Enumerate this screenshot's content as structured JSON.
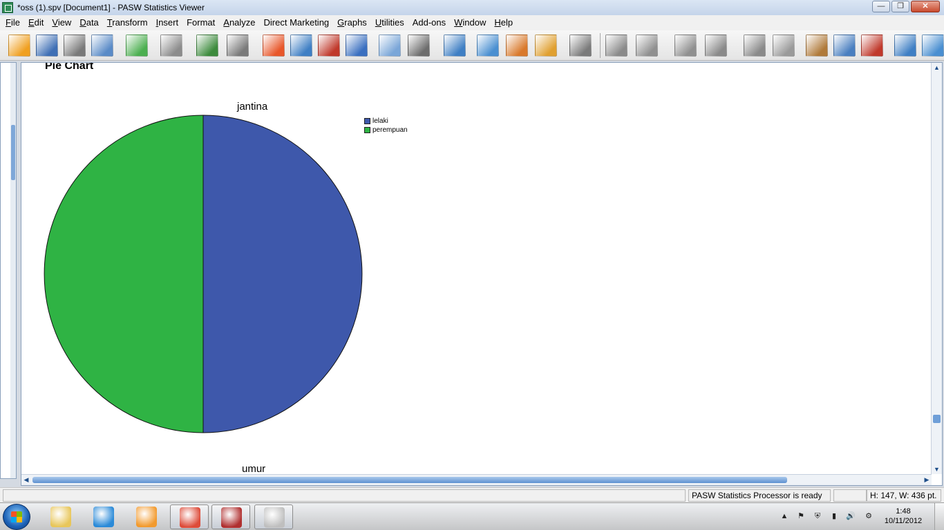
{
  "window": {
    "title": "*oss (1).spv [Document1] - PASW Statistics Viewer",
    "minimize_glyph": "—",
    "maximize_glyph": "❐",
    "close_glyph": "✕"
  },
  "menu": [
    {
      "label": "File",
      "accel": "F",
      "rest": "ile"
    },
    {
      "label": "Edit",
      "accel": "E",
      "rest": "dit"
    },
    {
      "label": "View",
      "accel": "V",
      "rest": "iew"
    },
    {
      "label": "Data",
      "accel": "D",
      "rest": "ata"
    },
    {
      "label": "Transform",
      "accel": "T",
      "rest": "ransform"
    },
    {
      "label": "Insert",
      "accel": "I",
      "rest": "nsert"
    },
    {
      "label": "Format",
      "accel": "",
      "rest": "Format"
    },
    {
      "label": "Analyze",
      "accel": "A",
      "rest": "nalyze"
    },
    {
      "label": "Direct Marketing",
      "accel": "",
      "rest": "Direct Marketing"
    },
    {
      "label": "Graphs",
      "accel": "G",
      "rest": "raphs"
    },
    {
      "label": "Utilities",
      "accel": "U",
      "rest": "tilities"
    },
    {
      "label": "Add-ons",
      "accel": "",
      "rest": "Add-ons"
    },
    {
      "label": "Window",
      "accel": "W",
      "rest": "indow"
    },
    {
      "label": "Help",
      "accel": "H",
      "rest": "elp"
    }
  ],
  "toolbar_icons": [
    "open-folder-icon",
    "save-icon",
    "print-icon",
    "print-preview-icon",
    "export-icon",
    "recall-dialog-icon",
    "undo-icon",
    "redo-icon",
    "goto-output-icon",
    "goto-case-icon",
    "goto-variable-icon",
    "variables-icon",
    "show-all-variables-icon",
    "hide-icon",
    "show-icon",
    "designate-window-icon",
    "insert-heading-icon",
    "insert-title-icon",
    "insert-text-icon",
    "insert-object-icon",
    "promote-icon",
    "demote-icon",
    "expand-icon",
    "collapse-icon",
    "show-item-icon",
    "hide-item-icon",
    "select-last-output-icon",
    "designate-viewer-icon",
    "create-pivot-icon",
    "output-options-icon"
  ],
  "viewer": {
    "section_heading": "Pie Chart",
    "next_chart_title": "umur"
  },
  "chart_data": {
    "type": "pie",
    "title": "jantina",
    "categories": [
      "lelaki",
      "perempuan"
    ],
    "values": [
      50,
      50
    ],
    "colors": [
      "#3e58ab",
      "#2fb344"
    ],
    "legend_position": "top-right"
  },
  "status": {
    "message": "PASW Statistics Processor is ready",
    "dimensions": "H: 147, W: 436 pt."
  },
  "taskbar": {
    "apps": [
      "file-explorer-icon",
      "internet-explorer-icon",
      "media-player-icon",
      "chrome-icon",
      "pasw-statistics-icon",
      "spss-graphics-icon"
    ],
    "tray_glyphs": [
      "▲",
      "⚑",
      "⛨",
      "▮",
      "🔊",
      "⚙"
    ],
    "clock_time": "1:48",
    "clock_date": "10/11/2012"
  }
}
